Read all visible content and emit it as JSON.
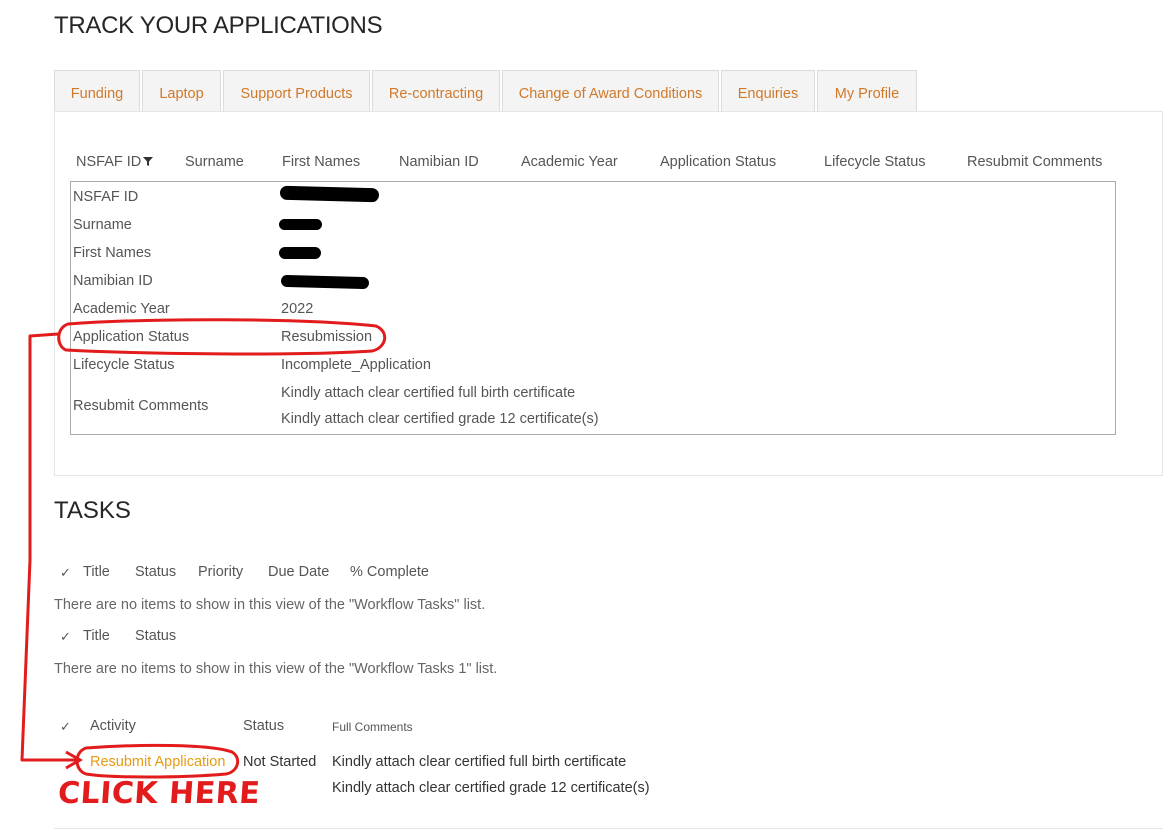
{
  "page": {
    "title": "TRACK YOUR APPLICATIONS"
  },
  "tabs": [
    {
      "label": "Funding"
    },
    {
      "label": "Laptop"
    },
    {
      "label": "Support Products"
    },
    {
      "label": "Re-contracting"
    },
    {
      "label": "Change of Award Conditions"
    },
    {
      "label": "Enquiries"
    },
    {
      "label": "My Profile"
    }
  ],
  "application_table": {
    "columns": [
      "NSFAF ID",
      "Surname",
      "First Names",
      "Namibian ID",
      "Academic Year",
      "Application Status",
      "Lifecycle Status",
      "Resubmit Comments"
    ],
    "details": {
      "labels": {
        "nsfaf_id": "NSFAF ID",
        "surname": "Surname",
        "first_names": "First Names",
        "namibian_id": "Namibian ID",
        "academic_year": "Academic Year",
        "application_status": "Application Status",
        "lifecycle_status": "Lifecycle Status",
        "resubmit_comments": "Resubmit Comments"
      },
      "values": {
        "academic_year": "2022",
        "application_status": "Resubmission",
        "lifecycle_status": "Incomplete_Application",
        "resubmit_comments": [
          "Kindly attach clear certified full birth certificate",
          "Kindly attach clear certified grade 12 certificate(s)"
        ]
      }
    }
  },
  "tasks": {
    "title": "TASKS",
    "workflow_tasks": {
      "headers": [
        "Title",
        "Status",
        "Priority",
        "Due Date",
        "% Complete"
      ],
      "empty_message": "There are no items to show in this view of the \"Workflow Tasks\" list."
    },
    "workflow_tasks_1": {
      "headers": [
        "Title",
        "Status"
      ],
      "empty_message": "There are no items to show in this view of the \"Workflow Tasks 1\" list."
    },
    "activities": {
      "headers": {
        "activity": "Activity",
        "status": "Status",
        "full_comments": "Full Comments"
      },
      "rows": [
        {
          "activity": "Resubmit Application",
          "status": "Not Started",
          "comments": [
            "Kindly attach clear certified full birth certificate",
            "Kindly attach clear certified grade 12 certificate(s)"
          ]
        }
      ]
    }
  },
  "annotation": {
    "text": "CLICK HERE",
    "color": "#e21c1c"
  },
  "colors": {
    "tab_text": "#d0792a",
    "link": "#e89a10"
  }
}
